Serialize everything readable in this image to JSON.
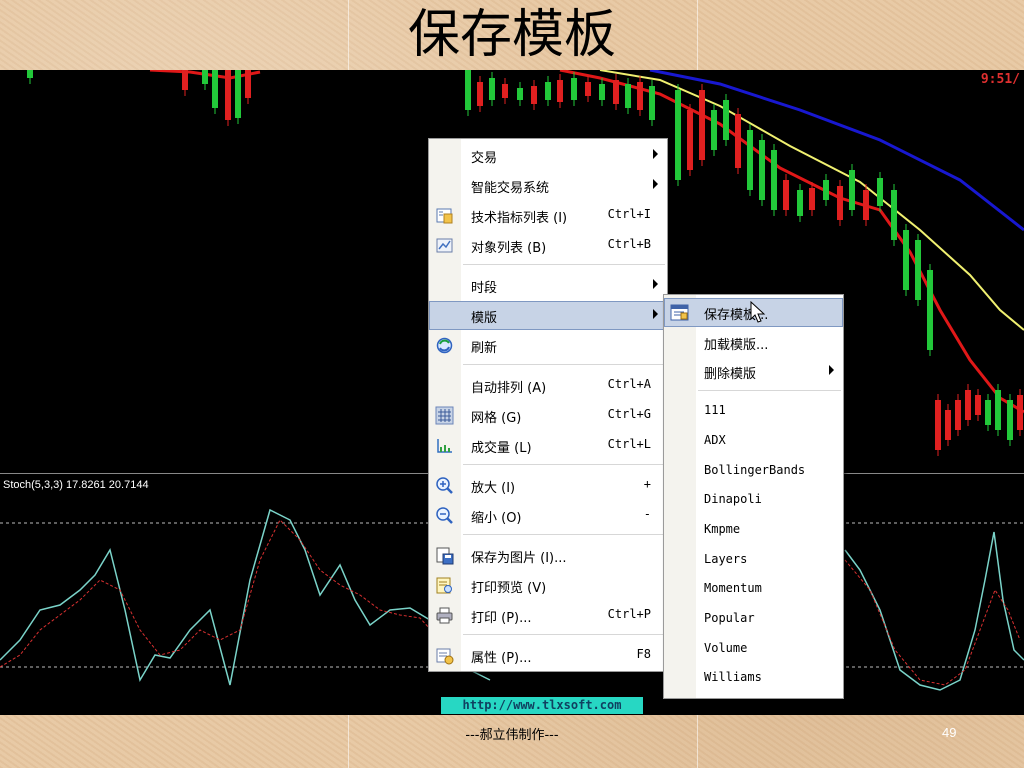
{
  "slide": {
    "title": "保存模板",
    "footer": "---郝立伟制作---",
    "page_number": "49"
  },
  "chart": {
    "clock": "9:51/",
    "stoch_label": "Stoch(5,3,3) 17.8261 20.7144",
    "url_banner": "http://www.tlxsoft.com"
  },
  "context_menu": {
    "items": [
      {
        "label": "交易",
        "shortcut": "",
        "submenu": true,
        "icon": ""
      },
      {
        "label": "智能交易系统",
        "shortcut": "",
        "submenu": true,
        "icon": ""
      },
      {
        "label": "技术指标列表 (I)",
        "shortcut": "Ctrl+I",
        "submenu": false,
        "icon": "indicator-list-icon"
      },
      {
        "label": "对象列表 (B)",
        "shortcut": "Ctrl+B",
        "submenu": false,
        "icon": "object-list-icon"
      },
      {
        "label": "时段",
        "shortcut": "",
        "submenu": true,
        "icon": ""
      },
      {
        "label": "模版",
        "shortcut": "",
        "submenu": true,
        "icon": ""
      },
      {
        "label": "刷新",
        "shortcut": "",
        "submenu": false,
        "icon": "refresh-icon"
      },
      {
        "label": "自动排列 (A)",
        "shortcut": "Ctrl+A",
        "submenu": false,
        "icon": ""
      },
      {
        "label": "网格 (G)",
        "shortcut": "Ctrl+G",
        "submenu": false,
        "icon": "grid-icon"
      },
      {
        "label": "成交量 (L)",
        "shortcut": "Ctrl+L",
        "submenu": false,
        "icon": "volume-icon"
      },
      {
        "label": "放大 (I)",
        "shortcut": "+",
        "submenu": false,
        "icon": "zoom-in-icon"
      },
      {
        "label": "缩小 (O)",
        "shortcut": "-",
        "submenu": false,
        "icon": "zoom-out-icon"
      },
      {
        "label": "保存为图片 (I)...",
        "shortcut": "",
        "submenu": false,
        "icon": "save-picture-icon"
      },
      {
        "label": "打印预览 (V)",
        "shortcut": "",
        "submenu": false,
        "icon": "print-preview-icon"
      },
      {
        "label": "打印 (P)...",
        "shortcut": "Ctrl+P",
        "submenu": false,
        "icon": "print-icon"
      },
      {
        "label": "属性 (P)...",
        "shortcut": "F8",
        "submenu": false,
        "icon": "properties-icon"
      }
    ],
    "highlighted": "模版"
  },
  "template_submenu": {
    "items": [
      {
        "label": "保存模板...",
        "submenu": false,
        "icon": "save-template-icon"
      },
      {
        "label": "加载模版...",
        "submenu": false,
        "icon": ""
      },
      {
        "label": "删除模版",
        "submenu": true,
        "icon": ""
      },
      {
        "label": "111",
        "submenu": false,
        "icon": ""
      },
      {
        "label": "ADX",
        "submenu": false,
        "icon": ""
      },
      {
        "label": "BollingerBands",
        "submenu": false,
        "icon": ""
      },
      {
        "label": "Dinapoli",
        "submenu": false,
        "icon": ""
      },
      {
        "label": "Kmpme",
        "submenu": false,
        "icon": ""
      },
      {
        "label": "Layers",
        "submenu": false,
        "icon": ""
      },
      {
        "label": "Momentum",
        "submenu": false,
        "icon": ""
      },
      {
        "label": "Popular",
        "submenu": false,
        "icon": ""
      },
      {
        "label": "Volume",
        "submenu": false,
        "icon": ""
      },
      {
        "label": "Williams",
        "submenu": false,
        "icon": ""
      }
    ],
    "highlighted": "保存模板..."
  },
  "colors": {
    "chart_bg": "#000000",
    "bull_candle": "#22c83a",
    "bear_candle": "#e02020",
    "ma_yellow": "#f0f070",
    "ma_red": "#e01818",
    "ma_blue": "#1818d0",
    "stoch_main": "#7ad3c9",
    "stoch_signal": "#d83030",
    "menu_highlight": "#c7d3e6"
  }
}
